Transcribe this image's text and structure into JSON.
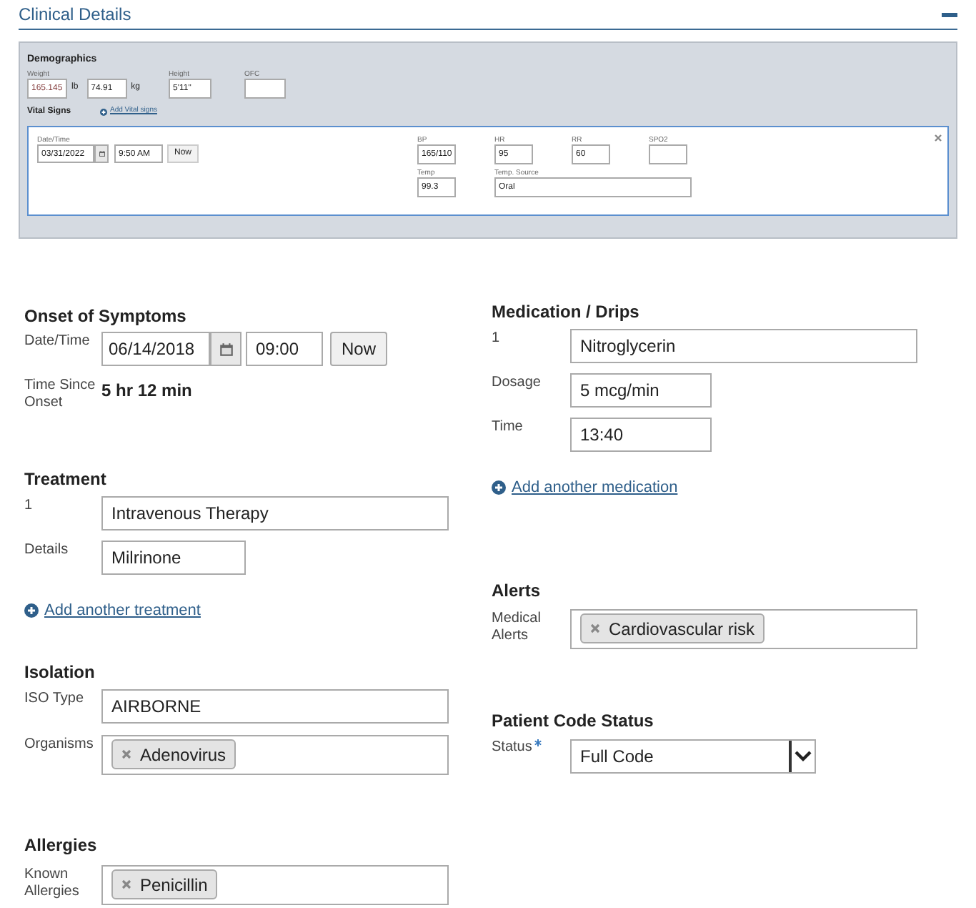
{
  "section": {
    "title": "Clinical Details",
    "expanded": true
  },
  "demographics": {
    "title": "Demographics",
    "weight_label": "Weight",
    "lb": "165.145",
    "lb_unit": "lb",
    "kg": "74.91",
    "kg_unit": "kg",
    "height_label": "Height",
    "height": "5'11\"",
    "ofc_label": "OFC"
  },
  "vital_signs": {
    "title": "Vital Signs",
    "add_link": "Add Vital signs",
    "date_label": "Date/Time",
    "date": "03/31/2022",
    "time": "9:50 AM",
    "now": "Now",
    "rows": [
      [
        {
          "label": "BP",
          "value": "165/110",
          "kind": "short"
        },
        {
          "label": "HR",
          "value": "95",
          "kind": "short"
        },
        {
          "label": "RR",
          "value": "60",
          "kind": "short"
        },
        {
          "label": "SPO2",
          "kind": "short"
        }
      ],
      [
        {
          "label": "Temp",
          "value": "99.3",
          "kind": "short"
        },
        {
          "label": "Temp. Source",
          "value": "Oral",
          "kind": "wide"
        }
      ]
    ]
  },
  "onset": {
    "title": "Onset of Symptoms",
    "date_label": "Date/Time",
    "date": "06/14/2018",
    "time": "09:00",
    "now": "Now",
    "since_label": "Time Since Onset",
    "since": "5 hr 12 min"
  },
  "treatment": {
    "title": "Treatment",
    "items": [
      {
        "number": "1",
        "value": "Intravenous Therapy",
        "details_label": "Details",
        "details": "Milrinone"
      }
    ],
    "add_link": "Add another treatment"
  },
  "isolation": {
    "title": "Isolation",
    "iso_label": "ISO Type",
    "iso": "AIRBORNE",
    "organisms_label": "Organisms",
    "organisms": [
      "Adenovirus"
    ]
  },
  "allergies": {
    "title": "Allergies",
    "label": "Known Allergies",
    "tags": [
      "Penicillin"
    ]
  },
  "medication": {
    "title": "Medication / Drips",
    "items": [
      {
        "number": "1",
        "name": "Nitroglycerin",
        "dosage_label": "Dosage",
        "dosage": "5 mcg/min",
        "time_label": "Time",
        "time": "13:40"
      }
    ],
    "add_link": "Add another medication"
  },
  "alerts": {
    "title": "Alerts",
    "label": "Medical Alerts",
    "tags": [
      "Cardiovascular risk"
    ]
  },
  "code_status": {
    "title": "Patient Code Status",
    "label": "Status",
    "required": true,
    "value": "Full Code"
  }
}
